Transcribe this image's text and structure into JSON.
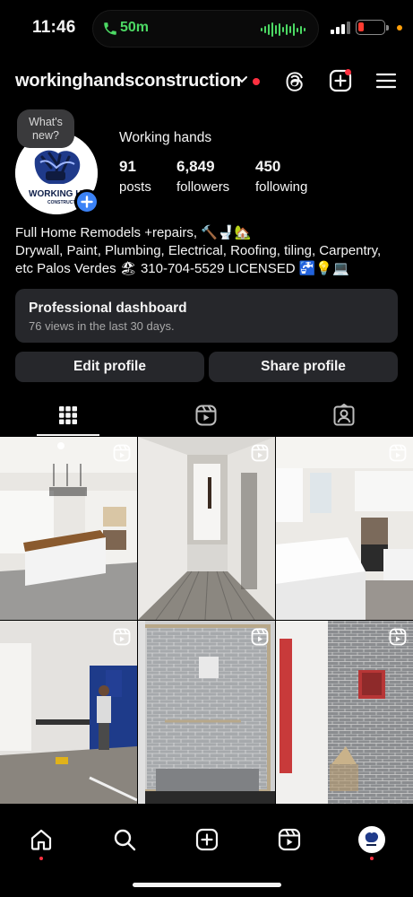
{
  "status_bar": {
    "time": "11:46",
    "call_duration": "50m",
    "icons": [
      "phone-icon",
      "audio-wave-icon",
      "cellular-signal-icon",
      "battery-icon"
    ]
  },
  "header": {
    "username": "workinghandsconstruction",
    "icons": [
      "chevron-down-icon",
      "threads-icon",
      "create-plus-icon",
      "menu-icon"
    ]
  },
  "profile": {
    "whats_new": "What's new?",
    "avatar_text": "WORKING HANDS",
    "avatar_subtext": "CONSTRUCTION",
    "display_name": "Working hands",
    "stats": [
      {
        "value": "91",
        "label": "posts"
      },
      {
        "value": "6,849",
        "label": "followers"
      },
      {
        "value": "450",
        "label": "following"
      }
    ],
    "bio_lines": [
      "Full Home Remodels +repairs, 🔨🚽🏡",
      "Drywall, Paint, Plumbing, Electrical, Roofing, tiling, Carpentry,",
      "etc Palos Verdes 🏖 310-704-5529 LICENSED 🚰💡💻"
    ]
  },
  "dashboard": {
    "title": "Professional dashboard",
    "subtitle": "76 views in the last 30 days."
  },
  "buttons": {
    "edit": "Edit profile",
    "share": "Share profile"
  },
  "tabs": [
    "grid-icon",
    "reels-icon",
    "tagged-icon"
  ],
  "posts": [
    {
      "type": "reel",
      "scene": "kitchen island with butcher block top"
    },
    {
      "type": "reel",
      "scene": "hallway with gray wood flooring"
    },
    {
      "type": "reel",
      "scene": "white kitchen with quartz countertops"
    },
    {
      "type": "reel",
      "scene": "living room with blue cabinetry and worker"
    },
    {
      "type": "reel",
      "scene": "glass shower enclosure with gray subway tile"
    },
    {
      "type": "reel",
      "scene": "shower tiling in progress with niche"
    }
  ],
  "bottom_nav": [
    "home-icon",
    "search-icon",
    "create-icon",
    "reels-icon",
    "profile-avatar"
  ],
  "colors": {
    "background": "#000000",
    "card": "#26272b",
    "accent_blue": "#3b82f6",
    "notification_red": "#ff3040",
    "call_green": "#4cd964"
  }
}
